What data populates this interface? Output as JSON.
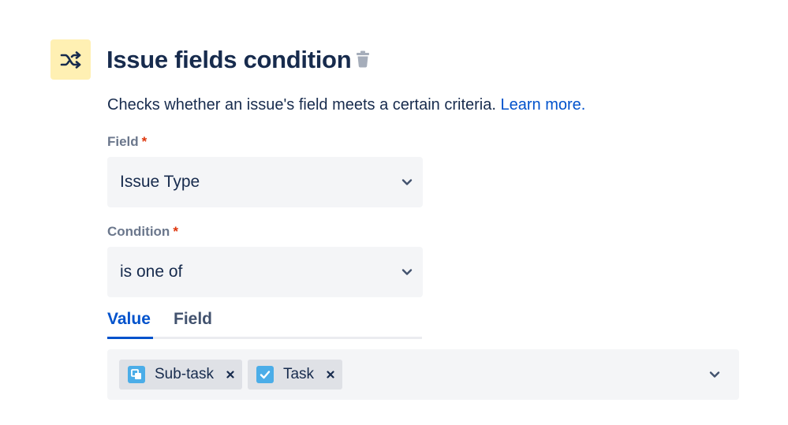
{
  "header": {
    "title": "Issue fields condition",
    "icon": "shuffle-icon",
    "accent_bg": "#fff0b3"
  },
  "description": {
    "text": "Checks whether an issue's field meets a certain criteria.",
    "link": "Learn more."
  },
  "field": {
    "label": "Field",
    "required_mark": "*",
    "value": "Issue Type"
  },
  "condition": {
    "label": "Condition",
    "required_mark": "*",
    "value": "is one of"
  },
  "tabs": [
    {
      "label": "Value",
      "active": true
    },
    {
      "label": "Field",
      "active": false
    }
  ],
  "values": [
    {
      "label": "Sub-task",
      "icon": "subtask-icon",
      "color": "#4bade8"
    },
    {
      "label": "Task",
      "icon": "task-check-icon",
      "color": "#4bade8"
    }
  ],
  "colors": {
    "link": "#0052cc",
    "required": "#de350b",
    "text": "#172b4d",
    "muted": "#6b778c"
  }
}
